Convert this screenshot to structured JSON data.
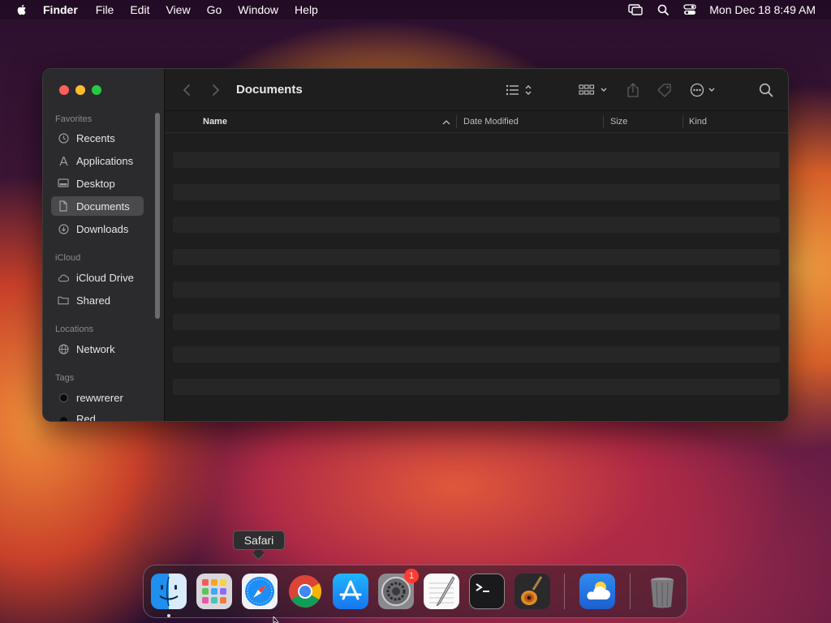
{
  "menubar": {
    "app_name": "Finder",
    "items": [
      "File",
      "Edit",
      "View",
      "Go",
      "Window",
      "Help"
    ],
    "clock": "Mon Dec 18  8:49 AM"
  },
  "window": {
    "title": "Documents",
    "sidebar": {
      "favorites_label": "Favorites",
      "favorites": [
        "Recents",
        "Applications",
        "Desktop",
        "Documents",
        "Downloads"
      ],
      "icloud_label": "iCloud",
      "icloud": [
        "iCloud Drive",
        "Shared"
      ],
      "locations_label": "Locations",
      "locations": [
        "Network"
      ],
      "tags_label": "Tags",
      "tags": [
        "rewwrerer",
        "Red"
      ]
    },
    "columns": {
      "name": "Name",
      "date_modified": "Date Modified",
      "size": "Size",
      "kind": "Kind"
    }
  },
  "dock": {
    "tooltip": "Safari",
    "apps": [
      "Finder",
      "Launchpad",
      "Safari",
      "Google Chrome",
      "App Store",
      "System Settings",
      "TextEdit",
      "Terminal",
      "GarageBand",
      "Weather",
      "Trash"
    ],
    "settings_badge": "1"
  },
  "colors": {
    "close": "#ff5f57",
    "minimize": "#febc2e",
    "zoom": "#28c840",
    "badge": "#ff3b30"
  }
}
